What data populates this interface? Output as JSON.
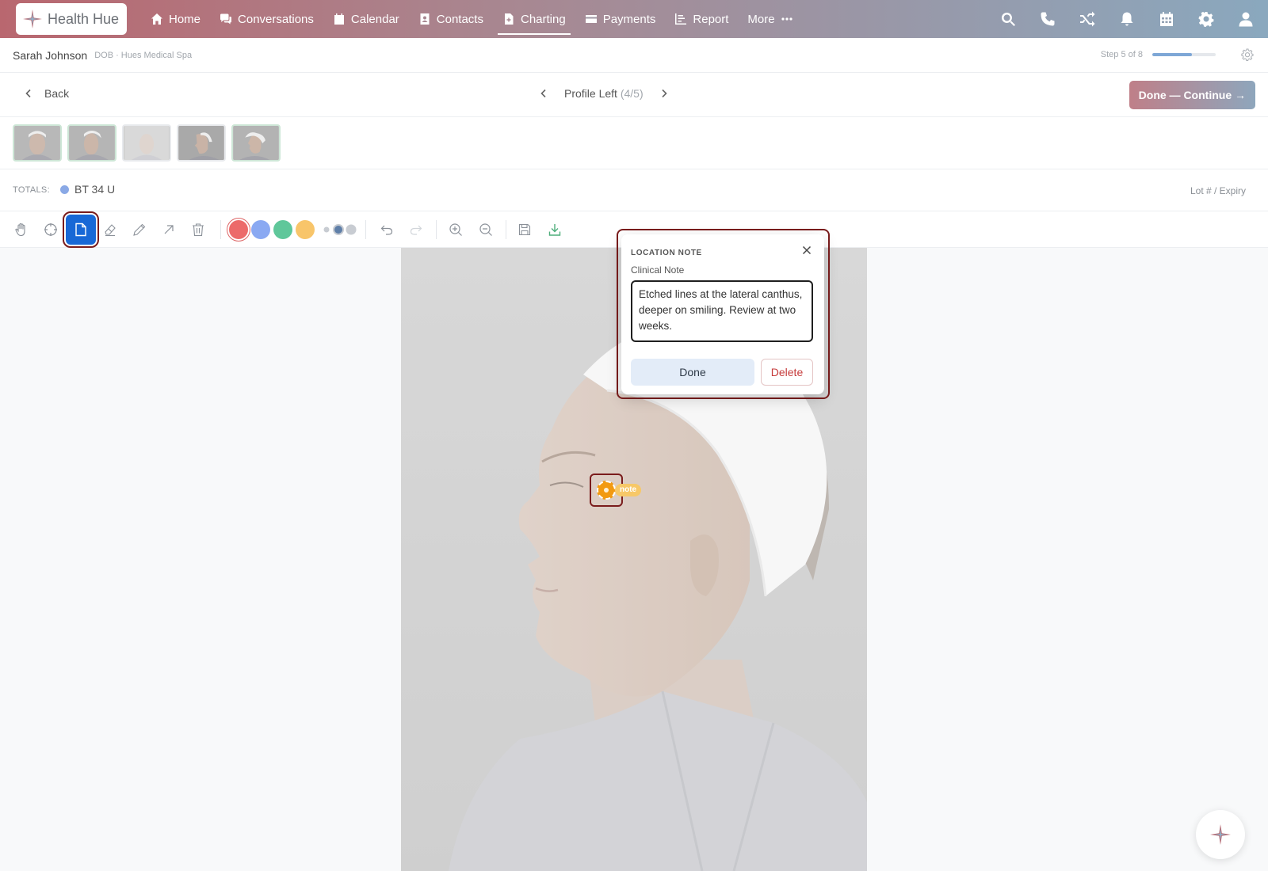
{
  "app": {
    "brand": "Health Hue"
  },
  "nav": {
    "items": [
      {
        "label": "Home",
        "icon": "home-icon"
      },
      {
        "label": "Conversations",
        "icon": "chat-icon"
      },
      {
        "label": "Calendar",
        "icon": "calendar-icon"
      },
      {
        "label": "Contacts",
        "icon": "contact-icon"
      },
      {
        "label": "Charting",
        "icon": "document-icon",
        "active": true
      },
      {
        "label": "Payments",
        "icon": "credit-card-icon"
      },
      {
        "label": "Report",
        "icon": "report-icon"
      },
      {
        "label": "More",
        "icon": "more-icon"
      }
    ],
    "right_icons": [
      "search-icon",
      "phone-icon",
      "shuffle-icon",
      "bell-icon",
      "calendar-grid-icon",
      "gear-icon",
      "user-icon"
    ],
    "gradient": [
      "#b9676f",
      "#8aa8be"
    ]
  },
  "patient": {
    "name": "Sarah Johnson",
    "meta": "DOB · Hues Medical Spa",
    "step_text": "Step 5 of 8",
    "progress": 0.625
  },
  "subheader": {
    "back": "Back",
    "view_label": "Profile Left",
    "view_count": "(4/5)",
    "continue": "Done — Continue →"
  },
  "totals": {
    "label": "TOTALS:",
    "value": "BT 34 U",
    "dot_color": "#8aa9e6",
    "lot": "Lot # / Expiry"
  },
  "toolbar": {
    "tools": [
      "hand-icon",
      "crosshair-icon",
      "note-icon",
      "eraser-icon",
      "pencil-icon",
      "arrow-icon",
      "trash-icon"
    ],
    "selected_tool": "note-icon",
    "colors": [
      "#ec6a6a",
      "#8aa9f2",
      "#5fc79a",
      "#f8c56a"
    ]
  },
  "popup": {
    "title": "LOCATION NOTE",
    "field_label": "Clinical Note",
    "note": "Etched lines at the lateral canthus, deeper on smiling. Review at two weeks.",
    "done": "Done",
    "delete": "Delete"
  },
  "marker": {
    "tag": "note",
    "color": "#f29a12"
  }
}
